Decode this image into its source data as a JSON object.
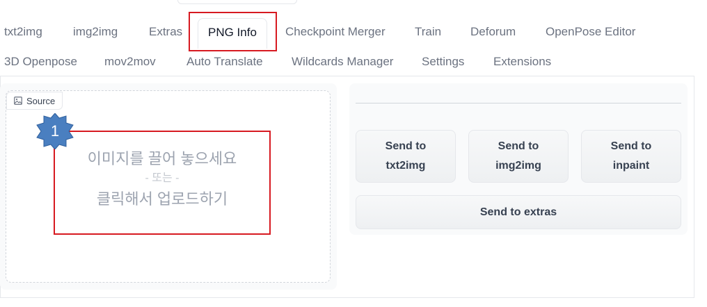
{
  "tabs": {
    "row1": [
      "txt2img",
      "img2img",
      "Extras",
      "PNG Info",
      "Checkpoint Merger",
      "Train",
      "Deforum",
      "OpenPose Editor"
    ],
    "row2": [
      "3D Openpose",
      "mov2mov",
      "Auto Translate",
      "Wildcards Manager",
      "Settings",
      "Extensions"
    ],
    "active": "PNG Info"
  },
  "source": {
    "label": "Source",
    "icon": "image-icon",
    "drop_line1": "이미지를 끌어 놓으세요",
    "drop_line2": "- 또는 -",
    "drop_line3": "클릭해서 업로드하기"
  },
  "annotation": {
    "badge_number": "1",
    "highlight_color": "#d71920",
    "badge_color": "#4a7fc0"
  },
  "actions": {
    "send_txt2img": "Send to\ntxt2img",
    "send_img2img": "Send to\nimg2img",
    "send_inpaint": "Send to\ninpaint",
    "send_extras": "Send to extras"
  }
}
